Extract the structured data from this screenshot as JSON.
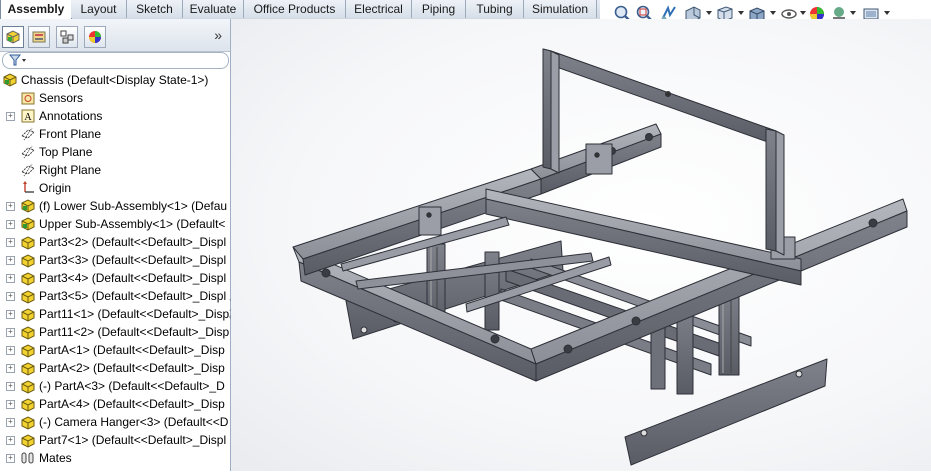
{
  "command_tabs": [
    {
      "label": "Assembly",
      "active": true
    },
    {
      "label": "Layout"
    },
    {
      "label": "Sketch"
    },
    {
      "label": "Evaluate"
    },
    {
      "label": "Office Products"
    },
    {
      "label": "Electrical"
    },
    {
      "label": "Piping"
    },
    {
      "label": "Tubing"
    },
    {
      "label": "Simulation"
    }
  ],
  "hud_icons": [
    "zoom-to-fit-icon",
    "zoom-to-area-icon",
    "previous-view-icon",
    "section-view-icon",
    "view-orientation-icon",
    "display-style-icon",
    "hide-show-items-icon",
    "edit-appearance-icon",
    "apply-scene-icon",
    "view-settings-icon"
  ],
  "panel": {
    "tabs": [
      "feature-manager-icon",
      "property-manager-icon",
      "configuration-manager-icon",
      "display-manager-icon"
    ],
    "expand_label": "»"
  },
  "tree": {
    "root": "Chassis  (Default<Display State-1>)",
    "items": [
      {
        "label": "Sensors",
        "icon": "sensors-icon",
        "expandable": false
      },
      {
        "label": "Annotations",
        "icon": "annotations-icon",
        "expandable": true
      },
      {
        "label": "Front Plane",
        "icon": "plane-icon",
        "expandable": false
      },
      {
        "label": "Top Plane",
        "icon": "plane-icon",
        "expandable": false
      },
      {
        "label": "Right Plane",
        "icon": "plane-icon",
        "expandable": false
      },
      {
        "label": "Origin",
        "icon": "origin-icon",
        "expandable": false
      },
      {
        "label": "(f) Lower Sub-Assembly<1> (Defau",
        "icon": "subassembly-icon",
        "expandable": true
      },
      {
        "label": "Upper Sub-Assembly<1> (Default<",
        "icon": "subassembly-icon",
        "expandable": true
      },
      {
        "label": "Part3<2> (Default<<Default>_Displ",
        "icon": "part-icon",
        "expandable": true
      },
      {
        "label": "Part3<3> (Default<<Default>_Displ",
        "icon": "part-icon",
        "expandable": true
      },
      {
        "label": "Part3<4> (Default<<Default>_Displ",
        "icon": "part-icon",
        "expandable": true
      },
      {
        "label": "Part3<5> (Default<<Default>_Displ",
        "icon": "part-icon",
        "expandable": true
      },
      {
        "label": "Part11<1> (Default<<Default>_Disp",
        "icon": "part-icon",
        "expandable": true
      },
      {
        "label": "Part11<2> (Default<<Default>_Disp",
        "icon": "part-icon",
        "expandable": true
      },
      {
        "label": "PartA<1> (Default<<Default>_Disp",
        "icon": "part-icon",
        "expandable": true
      },
      {
        "label": "PartA<2> (Default<<Default>_Disp",
        "icon": "part-icon",
        "expandable": true
      },
      {
        "label": "(-) PartA<3> (Default<<Default>_D",
        "icon": "part-icon",
        "expandable": true
      },
      {
        "label": "PartA<4> (Default<<Default>_Disp",
        "icon": "part-icon",
        "expandable": true
      },
      {
        "label": "(-) Camera Hanger<3> (Default<<D",
        "icon": "part-icon",
        "expandable": true
      },
      {
        "label": "Part7<1> (Default<<Default>_Displ",
        "icon": "part-icon",
        "expandable": true
      },
      {
        "label": "Mates",
        "icon": "mates-icon",
        "expandable": true
      }
    ]
  },
  "colors": {
    "frame": "#7a7c86",
    "frame_dark": "#4a4c55",
    "frame_light": "#a7a9b2"
  }
}
